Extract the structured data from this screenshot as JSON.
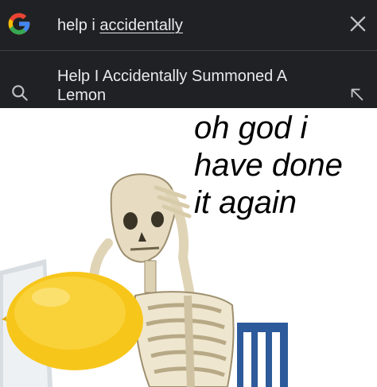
{
  "search": {
    "query_prefix": "help i ",
    "query_underlined": "accidentally",
    "value": "help i accidentally",
    "clear_icon": "close-icon"
  },
  "suggestion": {
    "line1": "Help I Accidentally Summoned A",
    "line2": "Lemon",
    "leading_icon": "search-icon",
    "trailing_icon": "arrow-up-left-icon"
  },
  "meme": {
    "caption": [
      "oh god i",
      "have done",
      "it again"
    ]
  },
  "colors": {
    "overlay_bg": "#202124",
    "overlay_text": "#e8eaed",
    "lemon": "#f7c61a",
    "bone": "#e7dcc2",
    "chair": "#2d5a9a"
  }
}
